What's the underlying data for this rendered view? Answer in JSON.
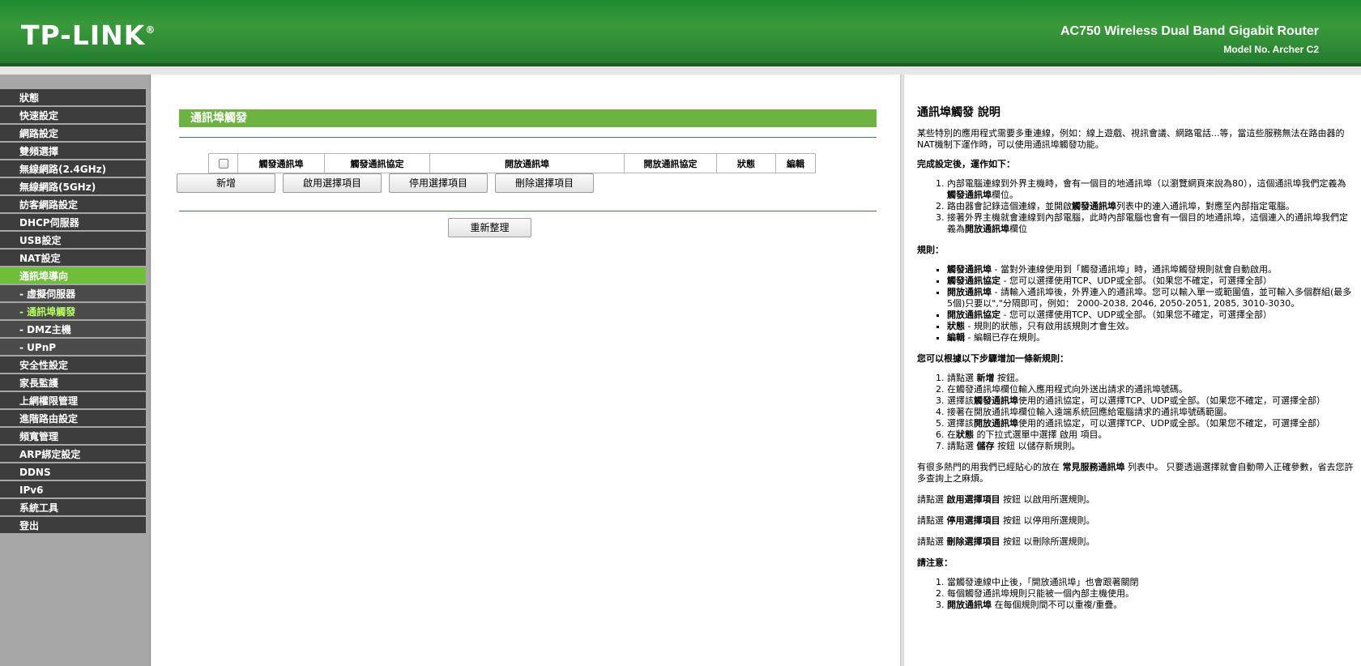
{
  "header": {
    "logo": "TP-LINK",
    "logo_mark": "®",
    "product": "AC750 Wireless Dual Band Gigabit Router",
    "model": "Model No. Archer C2"
  },
  "menu": [
    {
      "label": "狀態",
      "type": "main"
    },
    {
      "label": "快速設定",
      "type": "main"
    },
    {
      "label": "網路設定",
      "type": "main"
    },
    {
      "label": "雙頻選擇",
      "type": "main"
    },
    {
      "label": "無線網路(2.4GHz)",
      "type": "main"
    },
    {
      "label": "無線網路(5GHz)",
      "type": "main"
    },
    {
      "label": "訪客網路設定",
      "type": "main"
    },
    {
      "label": "DHCP伺服器",
      "type": "main"
    },
    {
      "label": "USB設定",
      "type": "main"
    },
    {
      "label": "NAT設定",
      "type": "main"
    },
    {
      "label": "通訊埠導向",
      "type": "active"
    },
    {
      "label": "- 虛擬伺服器",
      "type": "sub"
    },
    {
      "label": "- 通訊埠觸發",
      "type": "sub-current"
    },
    {
      "label": "- DMZ主機",
      "type": "sub"
    },
    {
      "label": "- UPnP",
      "type": "sub"
    },
    {
      "label": "安全性設定",
      "type": "main"
    },
    {
      "label": "家長監護",
      "type": "main"
    },
    {
      "label": "上網權限管理",
      "type": "main"
    },
    {
      "label": "進階路由設定",
      "type": "main"
    },
    {
      "label": "頻寬管理",
      "type": "main"
    },
    {
      "label": "ARP綁定設定",
      "type": "main"
    },
    {
      "label": "DDNS",
      "type": "main"
    },
    {
      "label": "IPv6",
      "type": "main"
    },
    {
      "label": "系統工具",
      "type": "main"
    },
    {
      "label": "登出",
      "type": "main"
    }
  ],
  "main": {
    "title": "通訊埠觸發",
    "table_headers": [
      "觸發通訊埠",
      "觸發通訊協定",
      "開放通訊埠",
      "開放通訊協定",
      "狀態",
      "編輯"
    ],
    "buttons": {
      "add": "新增",
      "enable": "啟用選擇項目",
      "disable": "停用選擇項目",
      "delete": "刪除選擇項目",
      "refresh": "重新整理"
    }
  },
  "help": {
    "title": "通訊埠觸發 說明",
    "intro": "某些特別的應用程式需要多重連線，例如：線上遊戲、視訊會議、網路電話...等，當這些服務無法在路由器的NAT機制下運作時，可以使用通訊埠觸發功能。",
    "how_heading": "完成設定後，運作如下：",
    "how_items": [
      [
        "內部電腦連線到外界主機時，會有一個目的地通訊埠（以瀏覽網頁來說為80），這個通訊埠我們定義為",
        "觸發通訊埠",
        "欄位。"
      ],
      [
        "路由器會記錄這個連線，並開啟",
        "觸發通訊埠",
        "列表中的連入通訊埠，對應至內部指定電腦。"
      ],
      [
        "接著外界主機就會連線到內部電腦，此時內部電腦也會有一個目的地通訊埠，這個連入的通訊埠我們定義為",
        "開放通訊埠",
        "欄位"
      ]
    ],
    "rules_heading": "規則：",
    "rules": [
      [
        "觸發通訊埠",
        " - 當對外連線使用到「觸發通訊埠」時，通訊埠觸發規則就會自動啟用。"
      ],
      [
        "觸發通訊協定",
        " - 您可以選擇使用TCP、UDP或全部。（如果您不確定，可選擇全部）"
      ],
      [
        "開放通訊埠",
        " - 請輸入通訊埠後，外界連入的通訊埠。您可以輸入單一或範圍值，並可輸入多個群組(最多5個)只要以\",\"分隔即可，例如： 2000-2038, 2046, 2050-2051, 2085, 3010-3030。"
      ],
      [
        "開放通訊協定",
        " - 您可以選擇使用TCP、UDP或全部。（如果您不確定，可選擇全部）"
      ],
      [
        "狀態",
        " - 規則的狀態，只有啟用該規則才會生效。"
      ],
      [
        "編輯",
        " - 編輯已存在規則。"
      ]
    ],
    "steps_heading": "您可以根據以下步驟增加一條新規則：",
    "steps": [
      [
        "請點選 ",
        "新增",
        " 按鈕。"
      ],
      [
        "在觸發通訊埠欄位輸入應用程式向外送出請求的通訊埠號碼。",
        "",
        ""
      ],
      [
        "選擇該",
        "觸發通訊埠",
        "使用的通訊協定，可以選擇TCP、UDP或全部。（如果您不確定，可選擇全部）"
      ],
      [
        "接著在開放通訊埠欄位輸入遠端系統回應給電腦請求的通訊埠號碼範圍。",
        "",
        ""
      ],
      [
        "選擇該",
        "開放通訊埠",
        "使用的通訊協定，可以選擇TCP、UDP或全部。（如果您不確定，可選擇全部）"
      ],
      [
        "在",
        "狀態",
        " 的下拉式選單中選擇 啟用 項目。"
      ],
      [
        "請點選 ",
        "儲存",
        " 按鈕 以儲存新規則。"
      ]
    ],
    "common_pre": "有很多熱門的用我們已經貼心的放在 ",
    "common_bold": "常見服務通訊埠",
    "common_post": " 列表中。 只要透過選擇就會自動帶入正確參數，省去您許多查詢上之麻煩。",
    "enable_pre": "請點選 ",
    "enable_bold": "啟用選擇項目",
    "enable_post": " 按鈕 以啟用所選規則。",
    "disable_pre": "請點選 ",
    "disable_bold": "停用選擇項目",
    "disable_post": " 按鈕 以停用所選規則。",
    "delete_pre": "請點選 ",
    "delete_bold": "刪除選擇項目",
    "delete_post": " 按鈕 以刪除所選規則。",
    "note_heading": "請注意：",
    "notes": [
      [
        "當觸發連線中止後，「開放通訊埠」也會跟著關閉",
        "",
        ""
      ],
      [
        "每個觸發通訊埠規則只能被一個內部主機使用。",
        "",
        ""
      ],
      [
        "",
        "開放通訊埠",
        " 在每個規則間不可以重複/重疊。"
      ]
    ]
  }
}
